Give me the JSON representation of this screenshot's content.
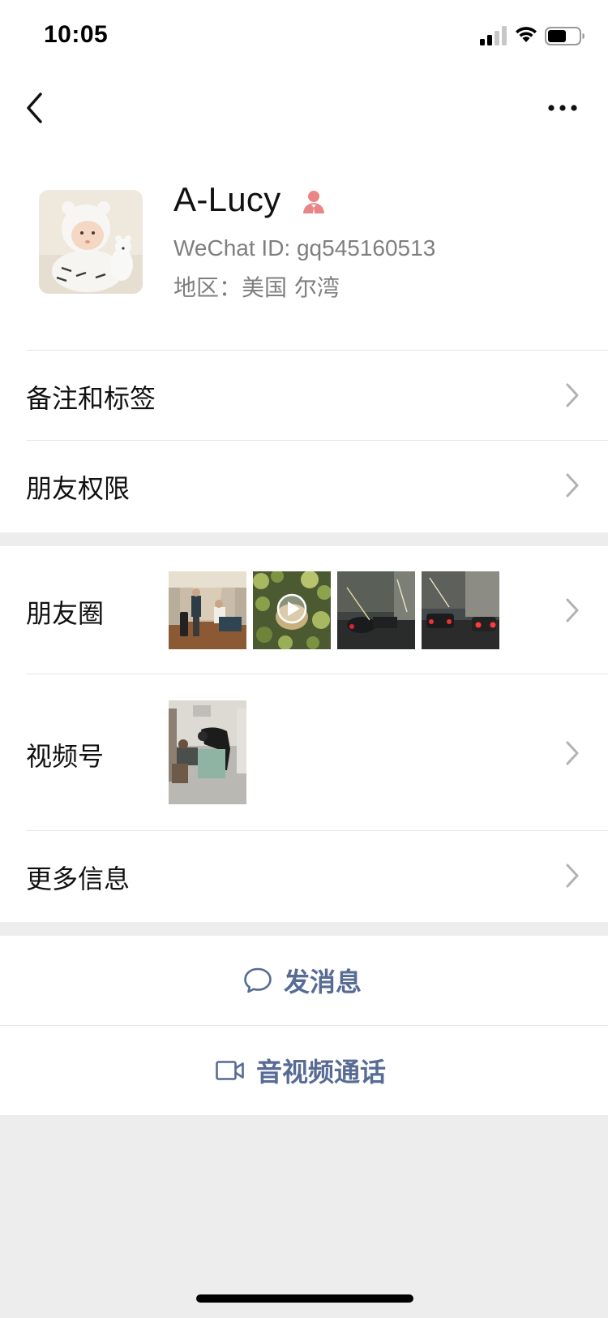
{
  "status_bar": {
    "time": "10:05",
    "signal_icon": "cellular-signal-icon",
    "wifi_icon": "wifi-icon",
    "battery_icon": "battery-icon"
  },
  "nav": {
    "back_icon": "chevron-left-icon",
    "more_icon": "ellipsis-icon"
  },
  "profile": {
    "name": "A-Lucy",
    "gender_icon": "female-icon",
    "gender_color": "#e98585",
    "wechat_id": "WeChat ID: gq545160513",
    "region": "地区：美国 尔湾"
  },
  "rows": {
    "remarks": {
      "label": "备注和标签"
    },
    "permissions": {
      "label": "朋友权限"
    },
    "moments": {
      "label": "朋友圈",
      "thumbnails": [
        "hallway-photo",
        "plant-video",
        "night-street-photo",
        "night-traffic-photo"
      ]
    },
    "channels": {
      "label": "视频号",
      "thumbnails": [
        "room-photo"
      ]
    },
    "more_info": {
      "label": "更多信息"
    }
  },
  "actions": {
    "message": {
      "label": "发消息",
      "icon": "chat-bubble-icon"
    },
    "call": {
      "label": "音视频通话",
      "icon": "video-camera-icon"
    }
  },
  "colors": {
    "link": "#576b95",
    "background": "#ededed",
    "secondary_text": "#7f7f7f"
  }
}
